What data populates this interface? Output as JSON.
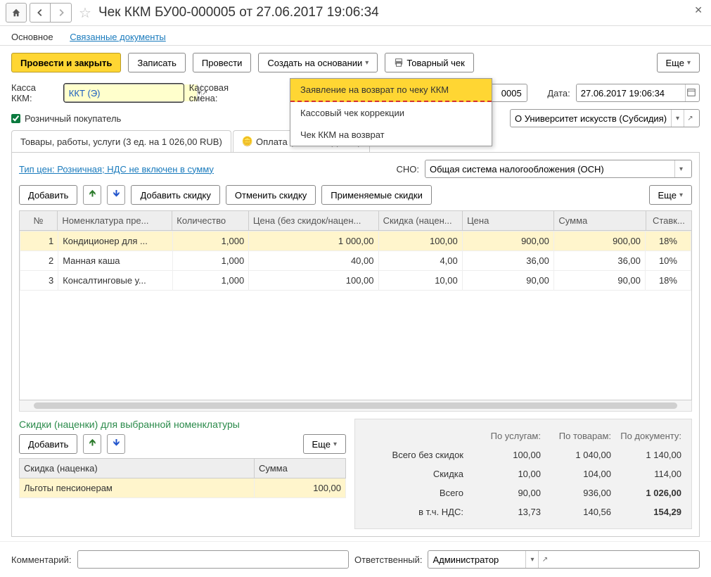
{
  "title": "Чек ККМ БУ00-000005 от 27.06.2017 19:06:34",
  "subnav": {
    "main": "Основное",
    "related": "Связанные документы"
  },
  "toolbar": {
    "post_close": "Провести и закрыть",
    "save": "Записать",
    "post": "Провести",
    "create_based": "Создать на основании",
    "goods_check": "Товарный чек",
    "more": "Еще"
  },
  "dropdown": {
    "item1": "Заявление на возврат по чеку ККМ",
    "item2": "Кассовый чек коррекции",
    "item3": "Чек ККМ на возврат"
  },
  "row1": {
    "kassa_label": "Касса ККМ:",
    "kassa_value": "ККТ (Э)",
    "shift_label": "Кассовая смена:",
    "number_value": "0005",
    "date_label": "Дата:",
    "date_value": "27.06.2017 19:06:34"
  },
  "retail_label": "Розничный покупатель",
  "org_value": "О Университет искусств (Субсидия)",
  "tabs": {
    "goods": "Товары, работы, услуги (3 ед. на 1 026,00 RUB)",
    "pay": "Оплата (0 RUB, ФД № 1)"
  },
  "price_link": "Тип цен: Розничная; НДС не включен в сумму",
  "sno_label": "СНО:",
  "sno_value": "Общая система налогообложения (ОСН)",
  "goods_tb": {
    "add": "Добавить",
    "add_discount": "Добавить скидку",
    "cancel_discount": "Отменить скидку",
    "applied_discounts": "Применяемые скидки",
    "more": "Еще"
  },
  "cols": {
    "n": "№",
    "nom": "Номенклатура пре...",
    "qty": "Количество",
    "price_nodiscount": "Цена (без скидок/нацен...",
    "discount": "Скидка (нацен...",
    "price": "Цена",
    "sum": "Сумма",
    "rate": "Ставк..."
  },
  "rows": [
    {
      "n": "1",
      "nom": "Кондиционер для ...",
      "qty": "1,000",
      "pnd": "1 000,00",
      "disc": "100,00",
      "price": "900,00",
      "sum": "900,00",
      "rate": "18%"
    },
    {
      "n": "2",
      "nom": "Манная каша",
      "qty": "1,000",
      "pnd": "40,00",
      "disc": "4,00",
      "price": "36,00",
      "sum": "36,00",
      "rate": "10%"
    },
    {
      "n": "3",
      "nom": "Консалтинговые у...",
      "qty": "1,000",
      "pnd": "100,00",
      "disc": "10,00",
      "price": "90,00",
      "sum": "90,00",
      "rate": "18%"
    }
  ],
  "discounts": {
    "title": "Скидки (наценки) для выбранной номенклатуры",
    "add": "Добавить",
    "more": "Еще",
    "col_name": "Скидка (наценка)",
    "col_sum": "Сумма",
    "row_name": "Льготы пенсионерам",
    "row_sum": "100,00"
  },
  "totals": {
    "h_services": "По услугам:",
    "h_goods": "По товарам:",
    "h_doc": "По документу:",
    "r1_label": "Всего без скидок",
    "r1_s": "100,00",
    "r1_g": "1 040,00",
    "r1_d": "1 140,00",
    "r2_label": "Скидка",
    "r2_s": "10,00",
    "r2_g": "104,00",
    "r2_d": "114,00",
    "r3_label": "Всего",
    "r3_s": "90,00",
    "r3_g": "936,00",
    "r3_d": "1 026,00",
    "r4_label": "в т.ч. НДС:",
    "r4_s": "13,73",
    "r4_g": "140,56",
    "r4_d": "154,29"
  },
  "footer": {
    "comment_label": "Комментарий:",
    "resp_label": "Ответственный:",
    "resp_value": "Администратор"
  }
}
